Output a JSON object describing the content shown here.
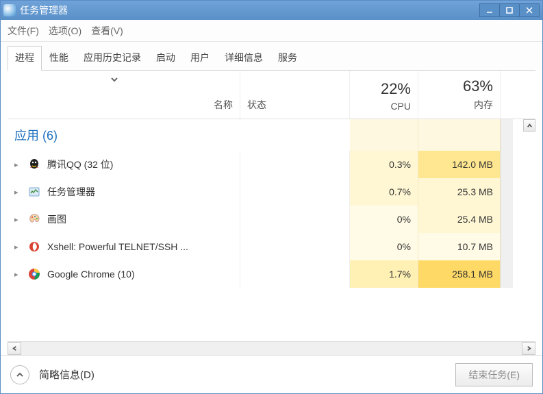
{
  "window": {
    "title": "任务管理器"
  },
  "menubar": {
    "items": [
      "文件(F)",
      "选项(O)",
      "查看(V)"
    ]
  },
  "tabs": {
    "items": [
      "进程",
      "性能",
      "应用历史记录",
      "启动",
      "用户",
      "详细信息",
      "服务"
    ],
    "active_index": 0
  },
  "columns": {
    "name": "名称",
    "status": "状态",
    "cpu_label": "CPU",
    "cpu_pct": "22%",
    "mem_label": "内存",
    "mem_pct": "63%"
  },
  "group": {
    "label": "应用 (6)"
  },
  "processes": [
    {
      "name": "腾讯QQ (32 位)",
      "icon": "qq",
      "cpu": "0.3%",
      "mem": "142.0 MB",
      "cpu_heat": "heat2",
      "mem_heat": "heat4",
      "expandable": true
    },
    {
      "name": "任务管理器",
      "icon": "taskmgr",
      "cpu": "0.7%",
      "mem": "25.3 MB",
      "cpu_heat": "heat2",
      "mem_heat": "heat2",
      "expandable": true
    },
    {
      "name": "画图",
      "icon": "paint",
      "cpu": "0%",
      "mem": "25.4 MB",
      "cpu_heat": "heat1",
      "mem_heat": "heat2",
      "expandable": true
    },
    {
      "name": "Xshell: Powerful TELNET/SSH ...",
      "icon": "xshell",
      "cpu": "0%",
      "mem": "10.7 MB",
      "cpu_heat": "heat1",
      "mem_heat": "heat1",
      "expandable": true
    },
    {
      "name": "Google Chrome (10)",
      "icon": "chrome",
      "cpu": "1.7%",
      "mem": "258.1 MB",
      "cpu_heat": "heat3",
      "mem_heat": "heat5",
      "expandable": true
    }
  ],
  "footer": {
    "collapse_label": "简略信息(D)",
    "end_task_label": "结束任务(E)"
  }
}
